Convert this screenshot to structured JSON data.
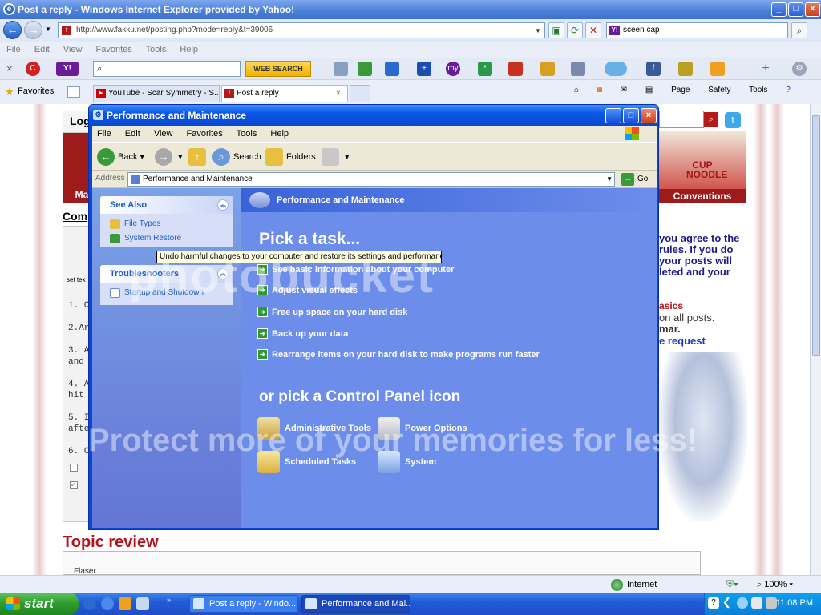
{
  "ie": {
    "title": "Post a reply - Windows Internet Explorer provided by Yahoo!",
    "url": "http://www.fakku.net/posting.php?mode=reply&t=39006",
    "search_value": "sceen cap",
    "menu": [
      "File",
      "Edit",
      "View",
      "Favorites",
      "Tools",
      "Help"
    ],
    "web_search_label": "WEB SEARCH",
    "favorites_label": "Favorites",
    "tabs": [
      {
        "label": "YouTube - Scar Symmetry - S..."
      },
      {
        "label": "Post a reply"
      }
    ],
    "commands": [
      "Page",
      "Safety",
      "Tools"
    ]
  },
  "page_bg": {
    "logo_fragment": "Log",
    "header_label": "Ma",
    "subject_label": "Com",
    "set_text": "set tex",
    "numbered": [
      "1. C",
      "2.Ar",
      "3. A",
      "and",
      "4. A",
      "hit",
      "5. I",
      "afte",
      "6. C"
    ],
    "rules_lines": [
      "you agree to the",
      "rules. If you do",
      "your posts will",
      "leted and your"
    ],
    "basics": "asics",
    "all_posts": "on all posts.",
    "mar": "mar.",
    "request": "e request",
    "conventions": "Conventions",
    "cup_noodle": "CUP NOODLE",
    "topic_review": "Topic review",
    "flaser": "Flaser"
  },
  "watermark": {
    "line1": "photobucket",
    "line2": "Protect more of your memories for less!"
  },
  "cpwin": {
    "title": "Performance and Maintenance",
    "menu": [
      "File",
      "Edit",
      "View",
      "Favorites",
      "Tools",
      "Help"
    ],
    "toolbar": {
      "back": "Back",
      "search": "Search",
      "folders": "Folders"
    },
    "address_label": "Address",
    "address_value": "Performance and Maintenance",
    "go": "Go",
    "see_also": {
      "title": "See Also",
      "items": [
        "File Types",
        "System Restore"
      ]
    },
    "troubleshooters": {
      "title": "Troubleshooters",
      "items": [
        "Startup and Shutdown"
      ]
    },
    "header": "Performance and Maintenance",
    "pick_task": "Pick a task...",
    "tasks": [
      "See basic information about your computer",
      "Adjust visual effects",
      "Free up space on your hard disk",
      "Back up your data",
      "Rearrange items on your hard disk to make programs run faster"
    ],
    "or_pick": "or pick a Control Panel icon",
    "icons": [
      "Administrative Tools",
      "Power Options",
      "Scheduled Tasks",
      "System"
    ]
  },
  "tooltip": "Undo harmful changes to your computer and restore its settings and performance.",
  "status": {
    "zone": "Internet",
    "zoom": "100%"
  },
  "taskbar": {
    "start": "start",
    "buttons": [
      "Post a reply - Windo...",
      "Performance and Mai..."
    ],
    "clock": "11:08 PM"
  }
}
